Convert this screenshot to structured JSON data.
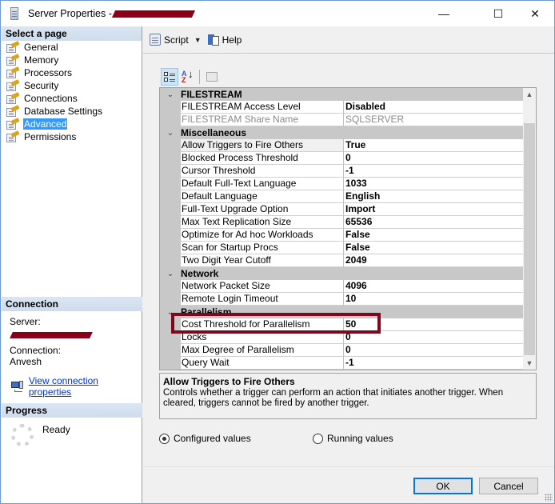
{
  "window": {
    "title": "Server Properties - ",
    "title_redacted": true,
    "controls": {
      "minimize": "—",
      "maximize": "☐",
      "close": "✕"
    }
  },
  "left_pane": {
    "select_page_header": "Select a page",
    "pages": [
      {
        "label": "General",
        "selected": false
      },
      {
        "label": "Memory",
        "selected": false
      },
      {
        "label": "Processors",
        "selected": false
      },
      {
        "label": "Security",
        "selected": false
      },
      {
        "label": "Connections",
        "selected": false
      },
      {
        "label": "Database Settings",
        "selected": false
      },
      {
        "label": "Advanced",
        "selected": true
      },
      {
        "label": "Permissions",
        "selected": false
      }
    ],
    "connection_header": "Connection",
    "server_label": "Server:",
    "server_value_redacted": true,
    "connection_label": "Connection:",
    "connection_value": "Anvesh",
    "view_connection_link": "View connection properties",
    "progress_header": "Progress",
    "progress_status": "Ready"
  },
  "toolbar": {
    "script_label": "Script",
    "help_label": "Help"
  },
  "property_grid": {
    "categories": [
      {
        "name": "FILESTREAM",
        "expanded": true,
        "rows": [
          {
            "name": "FILESTREAM Access Level",
            "value": "Disabled",
            "disabled": false
          },
          {
            "name": "FILESTREAM Share Name",
            "value": "SQLSERVER",
            "disabled": true
          }
        ]
      },
      {
        "name": "Miscellaneous",
        "expanded": true,
        "rows": [
          {
            "name": "Allow Triggers to Fire Others",
            "value": "True",
            "selected": true
          },
          {
            "name": "Blocked Process Threshold",
            "value": "0"
          },
          {
            "name": "Cursor Threshold",
            "value": "-1"
          },
          {
            "name": "Default Full-Text Language",
            "value": "1033"
          },
          {
            "name": "Default Language",
            "value": "English"
          },
          {
            "name": "Full-Text Upgrade Option",
            "value": "Import"
          },
          {
            "name": "Max Text Replication Size",
            "value": "65536"
          },
          {
            "name": "Optimize for Ad hoc Workloads",
            "value": "False"
          },
          {
            "name": "Scan for Startup Procs",
            "value": "False"
          },
          {
            "name": "Two Digit Year Cutoff",
            "value": "2049"
          }
        ]
      },
      {
        "name": "Network",
        "expanded": true,
        "rows": [
          {
            "name": "Network Packet Size",
            "value": "4096"
          },
          {
            "name": "Remote Login Timeout",
            "value": "10"
          }
        ]
      },
      {
        "name": "Parallelism",
        "expanded": true,
        "rows": [
          {
            "name": "Cost Threshold for Parallelism",
            "value": "50",
            "highlighted": true
          },
          {
            "name": "Locks",
            "value": "0"
          },
          {
            "name": "Max Degree of Parallelism",
            "value": "0"
          },
          {
            "name": "Query Wait",
            "value": "-1"
          }
        ]
      }
    ],
    "highlight_color": "#7d0a1c"
  },
  "description": {
    "title": "Allow Triggers to Fire Others",
    "text": "Controls whether a trigger can perform an action that initiates another trigger. When cleared, triggers cannot be fired by another trigger."
  },
  "value_mode": {
    "configured_label": "Configured values",
    "running_label": "Running values",
    "selected": "configured"
  },
  "buttons": {
    "ok": "OK",
    "cancel": "Cancel"
  }
}
